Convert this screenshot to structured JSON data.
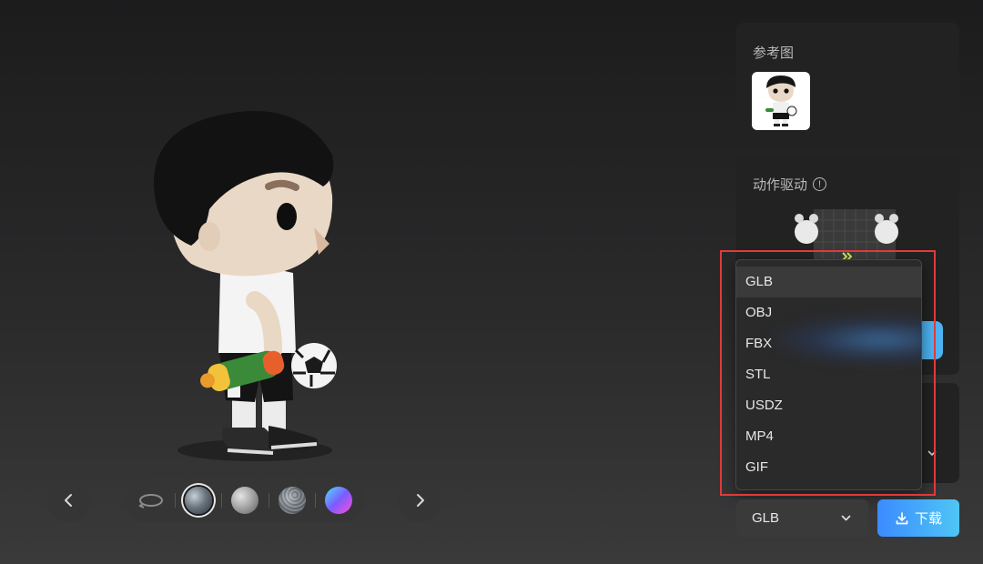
{
  "reference": {
    "title": "参考图",
    "thumb_icon": "reference-character-thumbnail"
  },
  "motion": {
    "title": "动作驱动",
    "info_icon": "info-icon",
    "preview_icon": "motion-preview-thumbnail"
  },
  "viewer": {
    "prev_icon": "chevron-left-icon",
    "next_icon": "chevron-right-icon",
    "materials": [
      {
        "name": "rotate",
        "icon": "rotate-icon"
      },
      {
        "name": "metal",
        "icon": "metal-sphere-icon",
        "selected": true
      },
      {
        "name": "matte",
        "icon": "matte-sphere-icon"
      },
      {
        "name": "stone",
        "icon": "stone-sphere-icon"
      },
      {
        "name": "gradient",
        "icon": "gradient-sphere-icon"
      }
    ]
  },
  "export": {
    "selected_format": "GLB",
    "download_label": "下载",
    "formats": [
      "GLB",
      "OBJ",
      "FBX",
      "STL",
      "USDZ",
      "MP4",
      "GIF"
    ]
  },
  "colors": {
    "accent_start": "#3b8bff",
    "accent_end": "#4fc6f5",
    "highlight": "#e03a3a",
    "panel": "#222223"
  }
}
